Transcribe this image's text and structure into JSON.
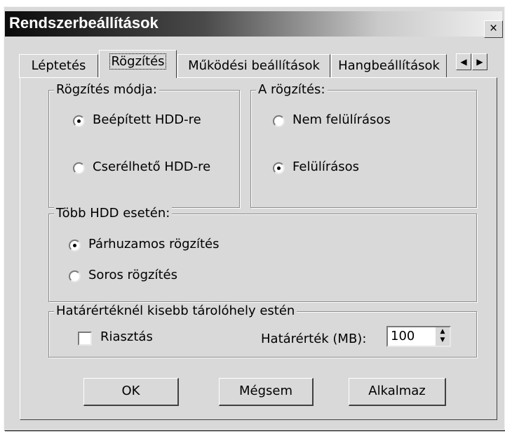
{
  "window": {
    "title": "Rendszerbeállítások",
    "close_label": "×"
  },
  "tabs": [
    {
      "label": "Léptetés"
    },
    {
      "label": "Rögzítés",
      "active": true
    },
    {
      "label": "Működési beállítások"
    },
    {
      "label": "Hangbeállítások"
    }
  ],
  "tab_scroll": {
    "left_icon": "left-arrow-icon",
    "right_icon": "right-arrow-icon"
  },
  "recording_mode": {
    "legend": "Rögzítés módja:",
    "options": [
      {
        "label": "Beépített HDD-re",
        "selected": true
      },
      {
        "label": "Cserélhető HDD-re",
        "selected": false
      }
    ]
  },
  "recording": {
    "legend": "A rögzítés:",
    "options": [
      {
        "label": "Nem felülírásos",
        "selected": false
      },
      {
        "label": "Felülírásos",
        "selected": true
      }
    ]
  },
  "multi_hdd": {
    "legend": "Több HDD esetén:",
    "options": [
      {
        "label": "Párhuzamos rögzítés",
        "selected": true
      },
      {
        "label": "Soros rögzítés",
        "selected": false
      }
    ]
  },
  "threshold": {
    "legend": "Határértéknél kisebb tárolóhely estén",
    "alarm_label": "Riasztás",
    "alarm_checked": false,
    "value_label": "Határérték (MB):",
    "value": "100"
  },
  "buttons": {
    "ok": "OK",
    "cancel": "Mégsem",
    "apply": "Alkalmaz"
  }
}
